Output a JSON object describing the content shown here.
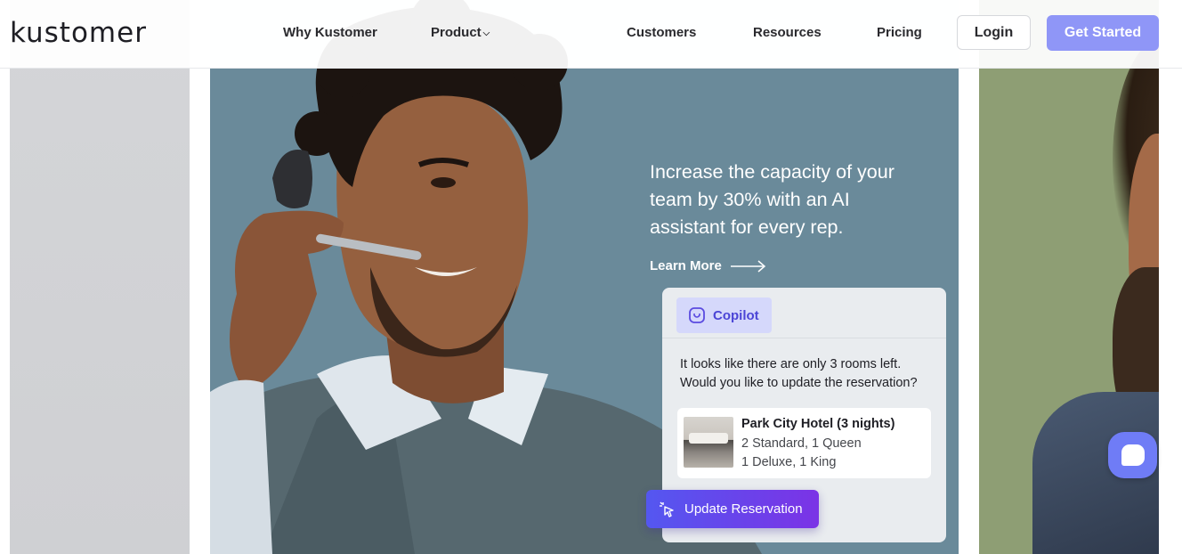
{
  "brand": {
    "logo_text": "kustomer",
    "accent": "#8f96f7",
    "hero_bg": "#6a8a9a"
  },
  "nav": {
    "items": [
      {
        "label": "Why Kustomer"
      },
      {
        "label": "Product"
      },
      {
        "label": "Customers"
      },
      {
        "label": "Resources"
      },
      {
        "label": "Pricing"
      }
    ],
    "login_label": "Login",
    "cta_label": "Get Started"
  },
  "hero": {
    "headline": "Increase the capacity of your team by 30% with an AI assistant for every rep.",
    "learn_more": "Learn More"
  },
  "copilot": {
    "chip_label": "Copilot",
    "message": "It looks like there are only 3 rooms left. Would you like to update the reservation?",
    "hotel": {
      "title": "Park City Hotel (3 nights)",
      "line1": "2 Standard, 1 Queen",
      "line2": "1 Deluxe, 1 King"
    },
    "action_label": "Update Reservation"
  },
  "icons": {
    "copilot": "copilot-icon",
    "cursor": "cursor-click-icon",
    "sparkle": "sparkle-icon",
    "chat": "chat-bubble-icon",
    "chevron": "chevron-down-icon",
    "arrow": "arrow-right-icon"
  }
}
